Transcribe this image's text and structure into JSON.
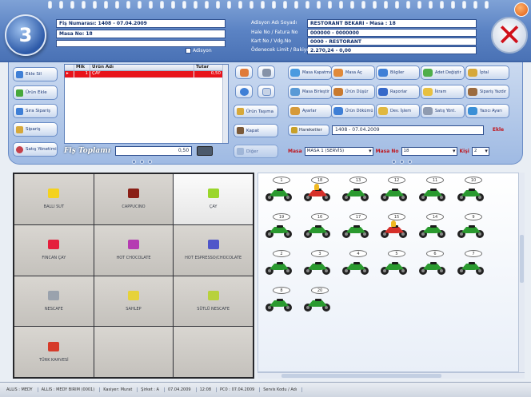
{
  "header": {
    "fis_no": "Fiş Numarası: 1408 - 07.04.2009",
    "masa": "Masa No: 18",
    "adisyon_label": "Adisyon",
    "info_labels": [
      "Adisyon Adı Soyadı",
      "Hale No / Fatura No",
      "Kart No / Vdg.No",
      "Ödenecek Limit / Bakiye"
    ],
    "info_values": [
      "RESTORANT BEKARI - Masa : 18",
      "000000 - 0000000",
      "0000 - RESTORANT",
      "2.270,24 - 0,00"
    ]
  },
  "left_buttons": [
    "Ekle Sil",
    "Ürün Ekle",
    "Sıra Sipariş",
    "Sipariş",
    "Satış Yönetimi"
  ],
  "grid": {
    "columns": [
      "Mik",
      "Ürün Adı",
      "Tutar"
    ],
    "rows": [
      [
        "1",
        "ÇAY",
        "0,50"
      ]
    ]
  },
  "middle_buttons": [
    "Ürün Taşıma",
    "Kapat",
    "Diğer"
  ],
  "total": {
    "label": "Fiş Toplamı",
    "value": "0,50"
  },
  "right_buttons": [
    "Masa Kapatma",
    "Masa Aç",
    "Bilgiler",
    "Adet Değiştir",
    "İptal",
    "Masa Birleştir",
    "Ürün Düşür",
    "Raporlar",
    "İkram",
    "Sipariş Yazdır",
    "Ayarlar",
    "Ürün Dökümü",
    "Dev. İşlem",
    "Satış Yönt.",
    "Yazıcı Ayarı"
  ],
  "tarife": {
    "button": "Hareketler",
    "value": "1408 - 07.04.2009",
    "red": "Ekle"
  },
  "filters": {
    "label1": "Masa",
    "value1": "MASA 1 (SERVİS)",
    "label2": "Masa No",
    "value2": "18",
    "label3": "Kişi",
    "value3": "2"
  },
  "products": [
    {
      "label": "BALLI SUT",
      "color": "#f4d21e"
    },
    {
      "label": "CAPPUCINO",
      "color": "#8a1f16"
    },
    {
      "label": "ÇAY",
      "color": "#9ad62b"
    },
    {
      "label": "FINCAN ÇAY",
      "color": "#e51e3c"
    },
    {
      "label": "HOT CHOCOLATE",
      "color": "#b53bb2"
    },
    {
      "label": "HOT ESPRESSO/CHOCOLATE",
      "color": "#4f56c9"
    },
    {
      "label": "NESCAFE",
      "color": "#9aa2ad"
    },
    {
      "label": "SAHLEP",
      "color": "#e6d23a"
    },
    {
      "label": "SÜTLÜ NESCAFE",
      "color": "#b8d13c"
    },
    {
      "label": "TÜRK KAHVESİ",
      "color": "#d63b2a"
    },
    {
      "label": "",
      "color": ""
    },
    {
      "label": "",
      "color": ""
    }
  ],
  "tables": [
    {
      "n": "1",
      "busy": false
    },
    {
      "n": "18",
      "busy": true
    },
    {
      "n": "13",
      "busy": false
    },
    {
      "n": "12",
      "busy": false
    },
    {
      "n": "11",
      "busy": false
    },
    {
      "n": "10",
      "busy": false
    },
    {
      "n": "19",
      "busy": false
    },
    {
      "n": "16",
      "busy": false
    },
    {
      "n": "17",
      "busy": false
    },
    {
      "n": "15",
      "busy": true
    },
    {
      "n": "14",
      "busy": false
    },
    {
      "n": "9",
      "busy": false
    },
    {
      "n": "2",
      "busy": false
    },
    {
      "n": "3",
      "busy": false
    },
    {
      "n": "4",
      "busy": false
    },
    {
      "n": "5",
      "busy": false
    },
    {
      "n": "6",
      "busy": false
    },
    {
      "n": "7",
      "busy": false
    },
    {
      "n": "8",
      "busy": false
    },
    {
      "n": "20",
      "busy": false
    }
  ],
  "status": [
    "ALLIS : MEDY",
    "ALLIS : MEDY BIRIM (0001)",
    "Kasiyer: Murat",
    "Şirket : A",
    "07.04.2009",
    "12:08",
    "PC0 : 07.04.2009",
    "Servis Kodu / Adı"
  ],
  "colors": {
    "header": "#5b83c4",
    "busy_table": "#d6302a",
    "free_table": "#2a9a2f",
    "selected_row": "#e8131a"
  }
}
